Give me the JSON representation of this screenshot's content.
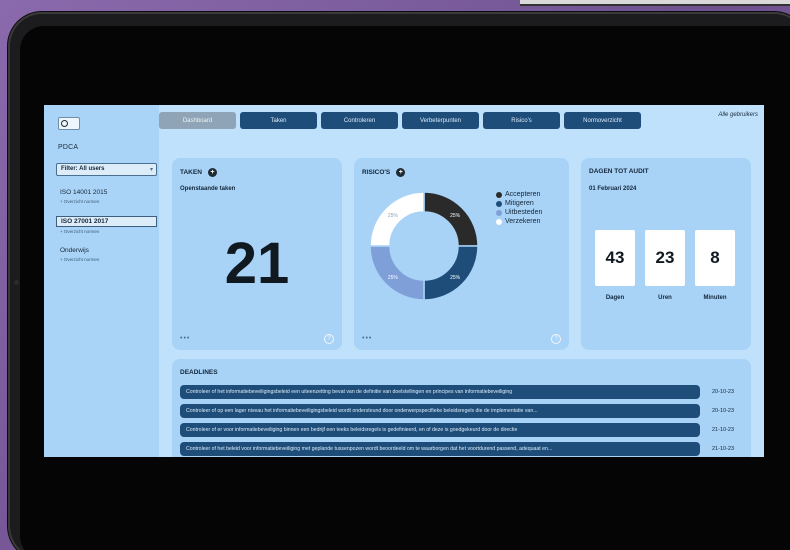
{
  "sidebar": {
    "section_title": "PDCA",
    "filter_value": "Filter: All users",
    "items": [
      {
        "label": "ISO 14001 2015",
        "sub": "+ Overzicht normen",
        "active": false
      },
      {
        "label": "ISO 27001 2017",
        "sub": "+ Overzicht normen",
        "active": true
      },
      {
        "label": "Onderwijs",
        "sub": "+ Overzicht normen",
        "active": false
      }
    ]
  },
  "tabs": [
    {
      "label": "Dashboard",
      "active": true
    },
    {
      "label": "Taken",
      "active": false
    },
    {
      "label": "Controleren",
      "active": false
    },
    {
      "label": "Verbeterpunten",
      "active": false
    },
    {
      "label": "Risico's",
      "active": false
    },
    {
      "label": "Normoverzicht",
      "active": false
    }
  ],
  "header": {
    "users_link": "Alle gebruikers"
  },
  "taken_card": {
    "title": "TAKEN",
    "subtitle": "Openstaande taken",
    "count": "21",
    "more": "•••"
  },
  "risico_card": {
    "title": "RISICO'S",
    "more": "•••",
    "chart_data": {
      "type": "pie",
      "categories": [
        "Accepteren",
        "Mitigeren",
        "Uitbesteden",
        "Verzekeren"
      ],
      "values": [
        25,
        25,
        25,
        25
      ],
      "labels": [
        "25%",
        "25%",
        "25%",
        "25%"
      ],
      "colors": [
        "#2a2a2a",
        "#1e4d7a",
        "#7f9fd9",
        "#ffffff"
      ],
      "donut": true
    }
  },
  "audit_card": {
    "title": "DAGEN TOT AUDIT",
    "date": "01 Februari 2024",
    "counters": [
      {
        "value": "43",
        "label": "Dagen"
      },
      {
        "value": "23",
        "label": "Uren"
      },
      {
        "value": "8",
        "label": "Minuten"
      }
    ]
  },
  "deadlines": {
    "title": "DEADLINES",
    "rows": [
      {
        "text": "Controleer of het informatiebeveiligingsbeleid een uiteenzetting bevat van de definitie van doelstellingen en principes van informatiebeveiliging",
        "date": "20-10-23"
      },
      {
        "text": "Controleer of op een lager niveau het informatiebeveiligingsbeleid wordt ondersteund door onderwerpspecifieke beleidsregels die de implementatie van...",
        "date": "20-10-23"
      },
      {
        "text": "Controleer of er voor informatiebeveiliging binnen een bedrijf een teeks beleidsregels is gedefinieerd, en of deze is goedgekeurd door de directie",
        "date": "21-10-23"
      },
      {
        "text": "Controleer of het beleid voor informatiebeveiliging met geplande tussenpozen wordt beoordeeld om te waarborgen dat het voortdurend passend, adequaat en...",
        "date": "21-10-23"
      }
    ]
  }
}
